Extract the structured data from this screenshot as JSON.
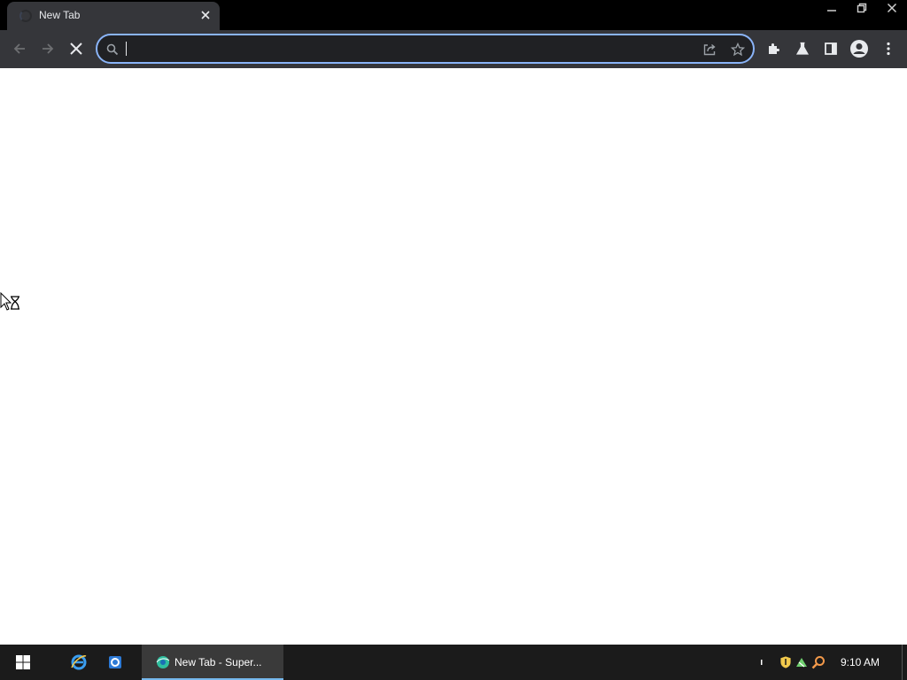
{
  "browser": {
    "tab": {
      "title": "New Tab",
      "close_icon": "close-icon",
      "favicon": "loading-spinner-icon"
    },
    "window_controls": [
      "minimize-icon",
      "restore-icon",
      "close-icon"
    ],
    "toolbar": {
      "back_icon": "back-arrow-icon",
      "forward_icon": "forward-arrow-icon",
      "stop_icon": "stop-loading-icon",
      "omnibox": {
        "value": "",
        "search_icon": "search-icon",
        "share_icon": "share-icon",
        "bookmark_icon": "star-icon"
      },
      "extensions_icon": "puzzle-icon",
      "labs_icon": "flask-icon",
      "side_panel_icon": "side-panel-icon",
      "profile_icon": "avatar-icon",
      "menu_icon": "kebab-menu-icon"
    },
    "colors": {
      "titlebar": "#000000",
      "toolbar": "#35363a",
      "omnibox_focus": "#8ab4f8",
      "content": "#ffffff"
    }
  },
  "taskbar": {
    "start_icon": "windows-logo-icon",
    "pinned": [
      "internet-explorer-icon",
      "app-icon"
    ],
    "active_task": {
      "label": "New Tab - Super...",
      "icon": "browser-icon"
    },
    "tray": [
      "shield-icon",
      "network-icon",
      "search-tool-icon"
    ],
    "clock": "9:10 AM"
  }
}
